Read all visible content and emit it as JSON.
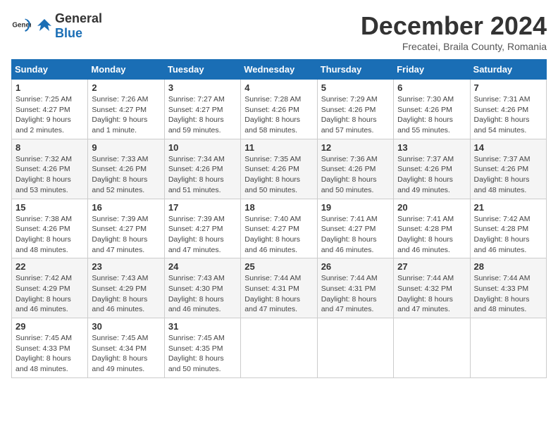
{
  "logo": {
    "text_general": "General",
    "text_blue": "Blue"
  },
  "calendar": {
    "title": "December 2024",
    "subtitle": "Frecatei, Braila County, Romania",
    "days_of_week": [
      "Sunday",
      "Monday",
      "Tuesday",
      "Wednesday",
      "Thursday",
      "Friday",
      "Saturday"
    ],
    "weeks": [
      [
        {
          "day": "1",
          "sunrise": "7:25 AM",
          "sunset": "4:27 PM",
          "daylight": "9 hours and 2 minutes."
        },
        {
          "day": "2",
          "sunrise": "7:26 AM",
          "sunset": "4:27 PM",
          "daylight": "9 hours and 1 minute."
        },
        {
          "day": "3",
          "sunrise": "7:27 AM",
          "sunset": "4:27 PM",
          "daylight": "8 hours and 59 minutes."
        },
        {
          "day": "4",
          "sunrise": "7:28 AM",
          "sunset": "4:26 PM",
          "daylight": "8 hours and 58 minutes."
        },
        {
          "day": "5",
          "sunrise": "7:29 AM",
          "sunset": "4:26 PM",
          "daylight": "8 hours and 57 minutes."
        },
        {
          "day": "6",
          "sunrise": "7:30 AM",
          "sunset": "4:26 PM",
          "daylight": "8 hours and 55 minutes."
        },
        {
          "day": "7",
          "sunrise": "7:31 AM",
          "sunset": "4:26 PM",
          "daylight": "8 hours and 54 minutes."
        }
      ],
      [
        {
          "day": "8",
          "sunrise": "7:32 AM",
          "sunset": "4:26 PM",
          "daylight": "8 hours and 53 minutes."
        },
        {
          "day": "9",
          "sunrise": "7:33 AM",
          "sunset": "4:26 PM",
          "daylight": "8 hours and 52 minutes."
        },
        {
          "day": "10",
          "sunrise": "7:34 AM",
          "sunset": "4:26 PM",
          "daylight": "8 hours and 51 minutes."
        },
        {
          "day": "11",
          "sunrise": "7:35 AM",
          "sunset": "4:26 PM",
          "daylight": "8 hours and 50 minutes."
        },
        {
          "day": "12",
          "sunrise": "7:36 AM",
          "sunset": "4:26 PM",
          "daylight": "8 hours and 50 minutes."
        },
        {
          "day": "13",
          "sunrise": "7:37 AM",
          "sunset": "4:26 PM",
          "daylight": "8 hours and 49 minutes."
        },
        {
          "day": "14",
          "sunrise": "7:37 AM",
          "sunset": "4:26 PM",
          "daylight": "8 hours and 48 minutes."
        }
      ],
      [
        {
          "day": "15",
          "sunrise": "7:38 AM",
          "sunset": "4:26 PM",
          "daylight": "8 hours and 48 minutes."
        },
        {
          "day": "16",
          "sunrise": "7:39 AM",
          "sunset": "4:27 PM",
          "daylight": "8 hours and 47 minutes."
        },
        {
          "day": "17",
          "sunrise": "7:39 AM",
          "sunset": "4:27 PM",
          "daylight": "8 hours and 47 minutes."
        },
        {
          "day": "18",
          "sunrise": "7:40 AM",
          "sunset": "4:27 PM",
          "daylight": "8 hours and 46 minutes."
        },
        {
          "day": "19",
          "sunrise": "7:41 AM",
          "sunset": "4:27 PM",
          "daylight": "8 hours and 46 minutes."
        },
        {
          "day": "20",
          "sunrise": "7:41 AM",
          "sunset": "4:28 PM",
          "daylight": "8 hours and 46 minutes."
        },
        {
          "day": "21",
          "sunrise": "7:42 AM",
          "sunset": "4:28 PM",
          "daylight": "8 hours and 46 minutes."
        }
      ],
      [
        {
          "day": "22",
          "sunrise": "7:42 AM",
          "sunset": "4:29 PM",
          "daylight": "8 hours and 46 minutes."
        },
        {
          "day": "23",
          "sunrise": "7:43 AM",
          "sunset": "4:29 PM",
          "daylight": "8 hours and 46 minutes."
        },
        {
          "day": "24",
          "sunrise": "7:43 AM",
          "sunset": "4:30 PM",
          "daylight": "8 hours and 46 minutes."
        },
        {
          "day": "25",
          "sunrise": "7:44 AM",
          "sunset": "4:31 PM",
          "daylight": "8 hours and 47 minutes."
        },
        {
          "day": "26",
          "sunrise": "7:44 AM",
          "sunset": "4:31 PM",
          "daylight": "8 hours and 47 minutes."
        },
        {
          "day": "27",
          "sunrise": "7:44 AM",
          "sunset": "4:32 PM",
          "daylight": "8 hours and 47 minutes."
        },
        {
          "day": "28",
          "sunrise": "7:44 AM",
          "sunset": "4:33 PM",
          "daylight": "8 hours and 48 minutes."
        }
      ],
      [
        {
          "day": "29",
          "sunrise": "7:45 AM",
          "sunset": "4:33 PM",
          "daylight": "8 hours and 48 minutes."
        },
        {
          "day": "30",
          "sunrise": "7:45 AM",
          "sunset": "4:34 PM",
          "daylight": "8 hours and 49 minutes."
        },
        {
          "day": "31",
          "sunrise": "7:45 AM",
          "sunset": "4:35 PM",
          "daylight": "8 hours and 50 minutes."
        },
        null,
        null,
        null,
        null
      ]
    ]
  }
}
